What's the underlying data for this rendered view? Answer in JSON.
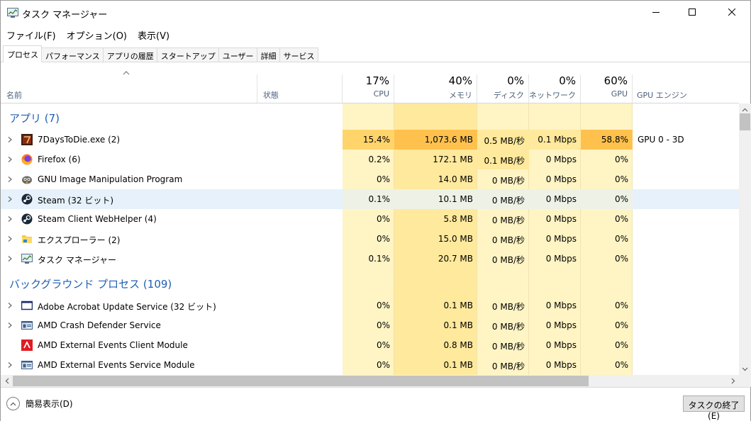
{
  "window": {
    "title": "タスク マネージャー"
  },
  "menu": [
    {
      "label": "ファイル(F)"
    },
    {
      "label": "オプション(O)"
    },
    {
      "label": "表示(V)"
    }
  ],
  "tabs": [
    {
      "label": "プロセス",
      "active": true
    },
    {
      "label": "パフォーマンス"
    },
    {
      "label": "アプリの履歴"
    },
    {
      "label": "スタートアップ"
    },
    {
      "label": "ユーザー"
    },
    {
      "label": "詳細"
    },
    {
      "label": "サービス"
    }
  ],
  "columns": {
    "name": "名前",
    "status": "状態",
    "cpu": {
      "percent": "17%",
      "label": "CPU"
    },
    "memory": {
      "percent": "40%",
      "label": "メモリ"
    },
    "disk": {
      "percent": "0%",
      "label": "ディスク"
    },
    "network": {
      "percent": "0%",
      "label": "ネットワーク"
    },
    "gpu": {
      "percent": "60%",
      "label": "GPU"
    },
    "gpu_engine": "GPU エンジン"
  },
  "groups": {
    "apps": "アプリ (7)",
    "background": "バックグラウンド プロセス (109)"
  },
  "processes": [
    {
      "name": "7DaysToDie.exe (2)",
      "icon": "7days-icon",
      "cpu": "15.4%",
      "mem": "1,073.6 MB",
      "disk": "0.5 MB/秒",
      "net": "0.1 Mbps",
      "gpu": "58.8%",
      "gpu_engine": "GPU 0 - 3D"
    },
    {
      "name": "Firefox (6)",
      "icon": "firefox-icon",
      "cpu": "0.2%",
      "mem": "172.1 MB",
      "disk": "0.1 MB/秒",
      "net": "0 Mbps",
      "gpu": "0%",
      "gpu_engine": ""
    },
    {
      "name": "GNU Image Manipulation Program",
      "icon": "gimp-icon",
      "cpu": "0%",
      "mem": "14.0 MB",
      "disk": "0 MB/秒",
      "net": "0 Mbps",
      "gpu": "0%",
      "gpu_engine": ""
    },
    {
      "name": "Steam (32 ビット)",
      "icon": "steam-icon",
      "cpu": "0.1%",
      "mem": "10.1 MB",
      "disk": "0 MB/秒",
      "net": "0 Mbps",
      "gpu": "0%",
      "gpu_engine": "",
      "selected": true
    },
    {
      "name": "Steam Client WebHelper (4)",
      "icon": "steam-icon",
      "cpu": "0%",
      "mem": "5.8 MB",
      "disk": "0 MB/秒",
      "net": "0 Mbps",
      "gpu": "0%",
      "gpu_engine": ""
    },
    {
      "name": "エクスプローラー (2)",
      "icon": "folder-icon",
      "cpu": "0%",
      "mem": "15.0 MB",
      "disk": "0 MB/秒",
      "net": "0 Mbps",
      "gpu": "0%",
      "gpu_engine": ""
    },
    {
      "name": "タスク マネージャー",
      "icon": "task-manager-icon",
      "cpu": "0.1%",
      "mem": "20.7 MB",
      "disk": "0 MB/秒",
      "net": "0 Mbps",
      "gpu": "0%",
      "gpu_engine": ""
    }
  ],
  "background_processes": [
    {
      "name": "Adobe Acrobat Update Service (32 ビット)",
      "icon": "service-window-icon",
      "cpu": "0%",
      "mem": "0.1 MB",
      "disk": "0 MB/秒",
      "net": "0 Mbps",
      "gpu": "0%",
      "expandable": true
    },
    {
      "name": "AMD Crash Defender Service",
      "icon": "service-icon",
      "cpu": "0%",
      "mem": "0.1 MB",
      "disk": "0 MB/秒",
      "net": "0 Mbps",
      "gpu": "0%",
      "expandable": true
    },
    {
      "name": "AMD External Events Client Module",
      "icon": "amd-icon",
      "cpu": "0%",
      "mem": "0.8 MB",
      "disk": "0 MB/秒",
      "net": "0 Mbps",
      "gpu": "0%",
      "expandable": false
    },
    {
      "name": "AMD External Events Service Module",
      "icon": "service-icon",
      "cpu": "0%",
      "mem": "0.1 MB",
      "disk": "0 MB/秒",
      "net": "0 Mbps",
      "gpu": "0%",
      "expandable": true
    }
  ],
  "footer": {
    "fewer_details": "簡易表示(D)",
    "end_task": "タスクの終了(E)"
  },
  "colors": {
    "heat_light": "#fff4c4",
    "heat_mid": "#ffe99c",
    "heat_strong": "#ffd46b",
    "heat_hot": "#ffc14d",
    "group_blue": "#1f5fb3",
    "header_label": "#4c607a"
  }
}
